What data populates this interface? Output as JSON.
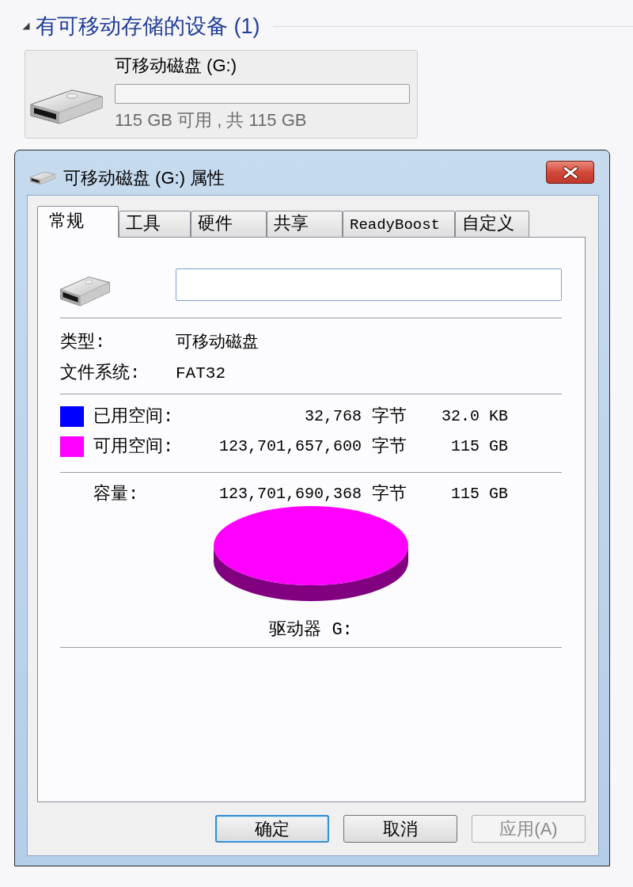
{
  "section": {
    "title": "有可移动存储的设备 (1)",
    "expanded": true
  },
  "drive_tile": {
    "name": "可移动磁盘 (G:)",
    "space_text": "115 GB 可用 , 共 115 GB"
  },
  "dialog": {
    "title": "可移动磁盘 (G:) 属性",
    "tabs": [
      {
        "label": "常规",
        "selected": true
      },
      {
        "label": "工具",
        "selected": false
      },
      {
        "label": "硬件",
        "selected": false
      },
      {
        "label": "共享",
        "selected": false
      },
      {
        "label": "ReadyBoost",
        "selected": false
      },
      {
        "label": "自定义",
        "selected": false
      }
    ],
    "properties": [
      {
        "label": "类型:",
        "value": "可移动磁盘"
      },
      {
        "label": "文件系统:",
        "value": "FAT32"
      }
    ],
    "space": [
      {
        "label": "已用空间:",
        "color": "#0000ff",
        "bytes": "32,768",
        "unit": "字节",
        "size": "32.0 KB"
      },
      {
        "label": "可用空间:",
        "color": "#ff00ff",
        "bytes": "123,701,657,600",
        "unit": "字节",
        "size": "115 GB"
      }
    ],
    "capacity": {
      "label": "容量:",
      "bytes": "123,701,690,368",
      "unit": "字节",
      "size": "115 GB"
    },
    "drive_label": "驱动器 G:",
    "buttons": [
      {
        "label": "确定",
        "default": true,
        "disabled": false
      },
      {
        "label": "取消",
        "default": false,
        "disabled": false
      },
      {
        "label": "应用(A)",
        "default": false,
        "disabled": true
      }
    ]
  }
}
